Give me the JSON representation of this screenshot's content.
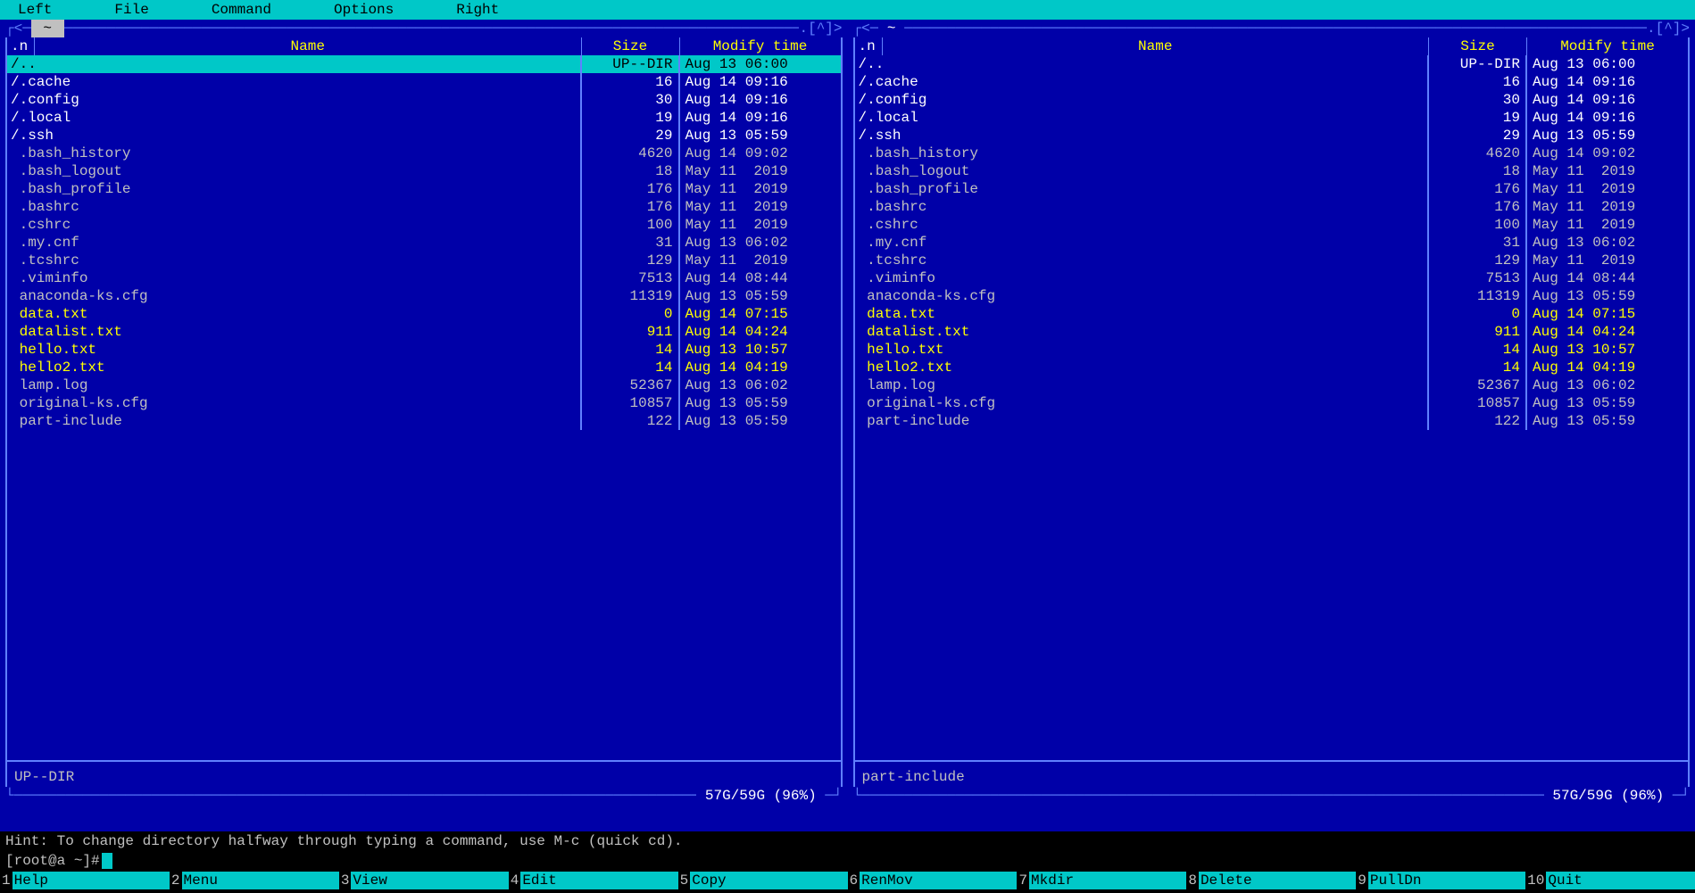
{
  "menubar": {
    "left": "Left",
    "file": "File",
    "command": "Command",
    "options": "Options",
    "right": "Right"
  },
  "panel_left": {
    "path": "~",
    "indicator": ".[^]>",
    "header_n": ".n",
    "header_name": "Name",
    "header_size": "Size",
    "header_mtime": "Modify time",
    "status": "UP--DIR",
    "disk": "57G/59G (96%)",
    "files": [
      {
        "name": "/..",
        "size": "UP--DIR",
        "mtime": "Aug 13 06:00",
        "type": "dir",
        "selected": true
      },
      {
        "name": "/.cache",
        "size": "16",
        "mtime": "Aug 14 09:16",
        "type": "dir"
      },
      {
        "name": "/.config",
        "size": "30",
        "mtime": "Aug 14 09:16",
        "type": "dir"
      },
      {
        "name": "/.local",
        "size": "19",
        "mtime": "Aug 14 09:16",
        "type": "dir"
      },
      {
        "name": "/.ssh",
        "size": "29",
        "mtime": "Aug 13 05:59",
        "type": "dir"
      },
      {
        "name": " .bash_history",
        "size": "4620",
        "mtime": "Aug 14 09:02",
        "type": "file"
      },
      {
        "name": " .bash_logout",
        "size": "18",
        "mtime": "May 11  2019",
        "type": "file"
      },
      {
        "name": " .bash_profile",
        "size": "176",
        "mtime": "May 11  2019",
        "type": "file"
      },
      {
        "name": " .bashrc",
        "size": "176",
        "mtime": "May 11  2019",
        "type": "file"
      },
      {
        "name": " .cshrc",
        "size": "100",
        "mtime": "May 11  2019",
        "type": "file"
      },
      {
        "name": " .my.cnf",
        "size": "31",
        "mtime": "Aug 13 06:02",
        "type": "file"
      },
      {
        "name": " .tcshrc",
        "size": "129",
        "mtime": "May 11  2019",
        "type": "file"
      },
      {
        "name": " .viminfo",
        "size": "7513",
        "mtime": "Aug 14 08:44",
        "type": "file"
      },
      {
        "name": " anaconda-ks.cfg",
        "size": "11319",
        "mtime": "Aug 13 05:59",
        "type": "file"
      },
      {
        "name": " data.txt",
        "size": "0",
        "mtime": "Aug 14 07:15",
        "type": "yellow"
      },
      {
        "name": " datalist.txt",
        "size": "911",
        "mtime": "Aug 14 04:24",
        "type": "yellow"
      },
      {
        "name": " hello.txt",
        "size": "14",
        "mtime": "Aug 13 10:57",
        "type": "yellow"
      },
      {
        "name": " hello2.txt",
        "size": "14",
        "mtime": "Aug 14 04:19",
        "type": "yellow"
      },
      {
        "name": " lamp.log",
        "size": "52367",
        "mtime": "Aug 13 06:02",
        "type": "file"
      },
      {
        "name": " original-ks.cfg",
        "size": "10857",
        "mtime": "Aug 13 05:59",
        "type": "file"
      },
      {
        "name": " part-include",
        "size": "122",
        "mtime": "Aug 13 05:59",
        "type": "file"
      }
    ]
  },
  "panel_right": {
    "path": "~",
    "indicator": ".[^]>",
    "header_n": ".n",
    "header_name": "Name",
    "header_size": "Size",
    "header_mtime": "Modify time",
    "status": "part-include",
    "disk": "57G/59G (96%)",
    "files": [
      {
        "name": "/..",
        "size": "UP--DIR",
        "mtime": "Aug 13 06:00",
        "type": "dir"
      },
      {
        "name": "/.cache",
        "size": "16",
        "mtime": "Aug 14 09:16",
        "type": "dir"
      },
      {
        "name": "/.config",
        "size": "30",
        "mtime": "Aug 14 09:16",
        "type": "dir"
      },
      {
        "name": "/.local",
        "size": "19",
        "mtime": "Aug 14 09:16",
        "type": "dir"
      },
      {
        "name": "/.ssh",
        "size": "29",
        "mtime": "Aug 13 05:59",
        "type": "dir"
      },
      {
        "name": " .bash_history",
        "size": "4620",
        "mtime": "Aug 14 09:02",
        "type": "file"
      },
      {
        "name": " .bash_logout",
        "size": "18",
        "mtime": "May 11  2019",
        "type": "file"
      },
      {
        "name": " .bash_profile",
        "size": "176",
        "mtime": "May 11  2019",
        "type": "file"
      },
      {
        "name": " .bashrc",
        "size": "176",
        "mtime": "May 11  2019",
        "type": "file"
      },
      {
        "name": " .cshrc",
        "size": "100",
        "mtime": "May 11  2019",
        "type": "file"
      },
      {
        "name": " .my.cnf",
        "size": "31",
        "mtime": "Aug 13 06:02",
        "type": "file"
      },
      {
        "name": " .tcshrc",
        "size": "129",
        "mtime": "May 11  2019",
        "type": "file"
      },
      {
        "name": " .viminfo",
        "size": "7513",
        "mtime": "Aug 14 08:44",
        "type": "file"
      },
      {
        "name": " anaconda-ks.cfg",
        "size": "11319",
        "mtime": "Aug 13 05:59",
        "type": "file"
      },
      {
        "name": " data.txt",
        "size": "0",
        "mtime": "Aug 14 07:15",
        "type": "yellow"
      },
      {
        "name": " datalist.txt",
        "size": "911",
        "mtime": "Aug 14 04:24",
        "type": "yellow"
      },
      {
        "name": " hello.txt",
        "size": "14",
        "mtime": "Aug 13 10:57",
        "type": "yellow"
      },
      {
        "name": " hello2.txt",
        "size": "14",
        "mtime": "Aug 14 04:19",
        "type": "yellow"
      },
      {
        "name": " lamp.log",
        "size": "52367",
        "mtime": "Aug 13 06:02",
        "type": "file"
      },
      {
        "name": " original-ks.cfg",
        "size": "10857",
        "mtime": "Aug 13 05:59",
        "type": "file"
      },
      {
        "name": " part-include",
        "size": "122",
        "mtime": "Aug 13 05:59",
        "type": "file"
      }
    ]
  },
  "hint": "Hint: To change directory halfway through typing a command, use M-c (quick cd).",
  "prompt": "[root@a ~]#",
  "fkeys": [
    {
      "n": "1",
      "label": "Help"
    },
    {
      "n": "2",
      "label": "Menu"
    },
    {
      "n": "3",
      "label": "View"
    },
    {
      "n": "4",
      "label": "Edit"
    },
    {
      "n": "5",
      "label": "Copy"
    },
    {
      "n": "6",
      "label": "RenMov"
    },
    {
      "n": "7",
      "label": "Mkdir"
    },
    {
      "n": "8",
      "label": "Delete"
    },
    {
      "n": "9",
      "label": "PullDn"
    },
    {
      "n": "10",
      "label": "Quit"
    }
  ]
}
